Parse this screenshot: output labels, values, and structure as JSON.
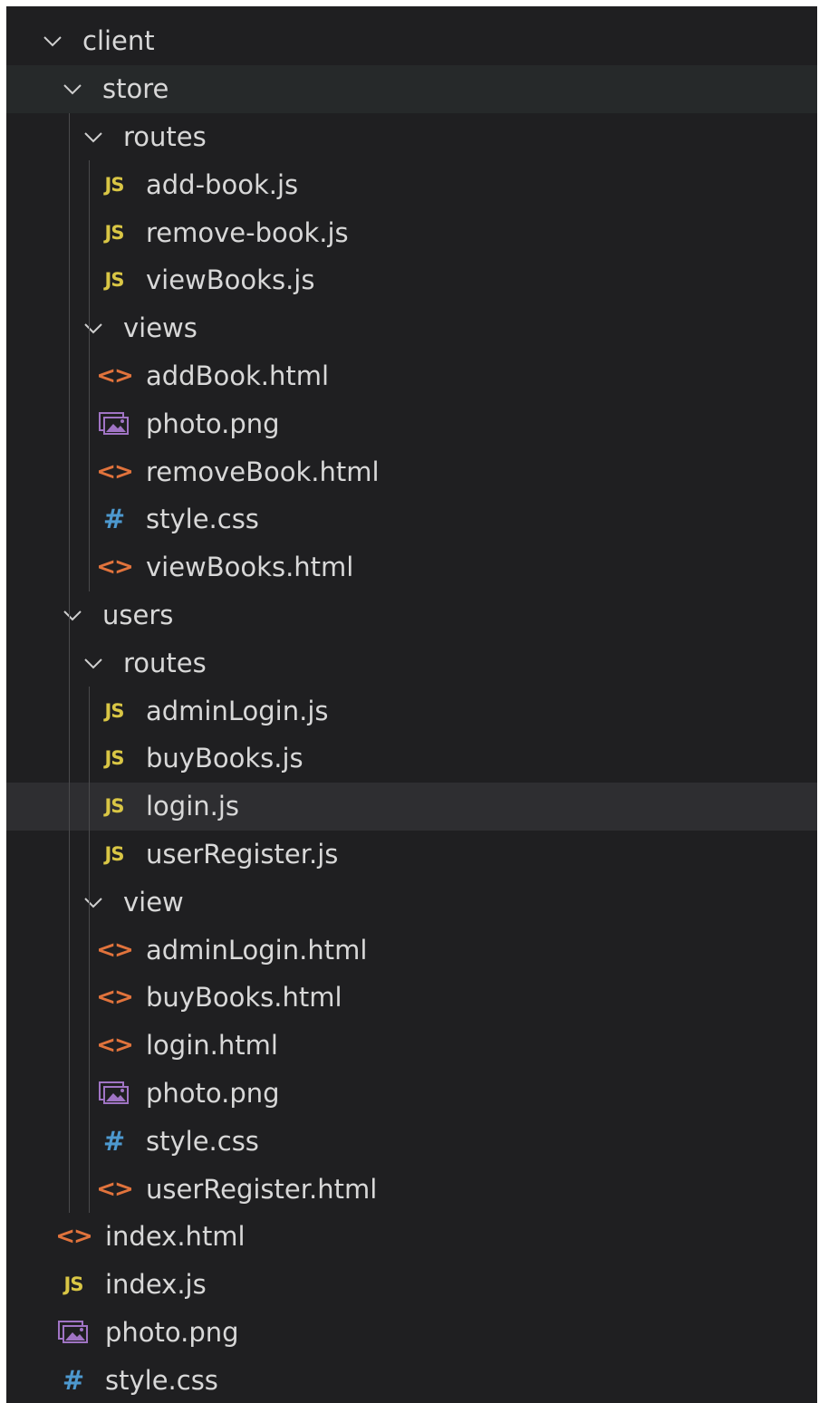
{
  "explorer": {
    "colors": {
      "background": "#1f1f21",
      "text": "#d8d8d8",
      "js_icon": "#d9c645",
      "html_icon": "#e1733c",
      "css_icon": "#4d99cf",
      "image_icon": "#a074c4"
    },
    "tree": [
      {
        "label": "client",
        "type": "folder",
        "icon": "chevron-down-icon",
        "depth": 0
      },
      {
        "label": "store",
        "type": "folder",
        "icon": "chevron-down-icon",
        "depth": 1
      },
      {
        "label": "routes",
        "type": "folder",
        "icon": "chevron-down-icon",
        "depth": 2
      },
      {
        "label": "add-book.js",
        "type": "js",
        "icon": "js-icon",
        "badge": "JS",
        "depth": 3
      },
      {
        "label": "remove-book.js",
        "type": "js",
        "icon": "js-icon",
        "badge": "JS",
        "depth": 3
      },
      {
        "label": "viewBooks.js",
        "type": "js",
        "icon": "js-icon",
        "badge": "JS",
        "depth": 3
      },
      {
        "label": "views",
        "type": "folder",
        "icon": "chevron-down-icon",
        "depth": 2
      },
      {
        "label": "addBook.html",
        "type": "html",
        "icon": "html-icon",
        "badge": "<>",
        "depth": 3
      },
      {
        "label": "photo.png",
        "type": "image",
        "icon": "image-icon",
        "depth": 3
      },
      {
        "label": "removeBook.html",
        "type": "html",
        "icon": "html-icon",
        "badge": "<>",
        "depth": 3
      },
      {
        "label": "style.css",
        "type": "css",
        "icon": "css-icon",
        "badge": "#",
        "depth": 3
      },
      {
        "label": "viewBooks.html",
        "type": "html",
        "icon": "html-icon",
        "badge": "<>",
        "depth": 3
      },
      {
        "label": "users",
        "type": "folder",
        "icon": "chevron-down-icon",
        "depth": 1
      },
      {
        "label": "routes",
        "type": "folder",
        "icon": "chevron-down-icon",
        "depth": 2
      },
      {
        "label": "adminLogin.js",
        "type": "js",
        "icon": "js-icon",
        "badge": "JS",
        "depth": 3
      },
      {
        "label": "buyBooks.js",
        "type": "js",
        "icon": "js-icon",
        "badge": "JS",
        "depth": 3
      },
      {
        "label": "login.js",
        "type": "js",
        "icon": "js-icon",
        "badge": "JS",
        "depth": 3,
        "hovered": true
      },
      {
        "label": "userRegister.js",
        "type": "js",
        "icon": "js-icon",
        "badge": "JS",
        "depth": 3
      },
      {
        "label": "view",
        "type": "folder",
        "icon": "chevron-down-icon",
        "depth": 2
      },
      {
        "label": "adminLogin.html",
        "type": "html",
        "icon": "html-icon",
        "badge": "<>",
        "depth": 3
      },
      {
        "label": "buyBooks.html",
        "type": "html",
        "icon": "html-icon",
        "badge": "<>",
        "depth": 3
      },
      {
        "label": "login.html",
        "type": "html",
        "icon": "html-icon",
        "badge": "<>",
        "depth": 3
      },
      {
        "label": "photo.png",
        "type": "image",
        "icon": "image-icon",
        "depth": 3
      },
      {
        "label": "style.css",
        "type": "css",
        "icon": "css-icon",
        "badge": "#",
        "depth": 3
      },
      {
        "label": "userRegister.html",
        "type": "html",
        "icon": "html-icon",
        "badge": "<>",
        "depth": 3
      },
      {
        "label": "index.html",
        "type": "html",
        "icon": "html-icon",
        "badge": "<>",
        "depth": 1
      },
      {
        "label": "index.js",
        "type": "js",
        "icon": "js-icon",
        "badge": "JS",
        "depth": 1
      },
      {
        "label": "photo.png",
        "type": "image",
        "icon": "image-icon",
        "depth": 1
      },
      {
        "label": "style.css",
        "type": "css",
        "icon": "css-icon",
        "badge": "#",
        "depth": 1
      }
    ]
  }
}
